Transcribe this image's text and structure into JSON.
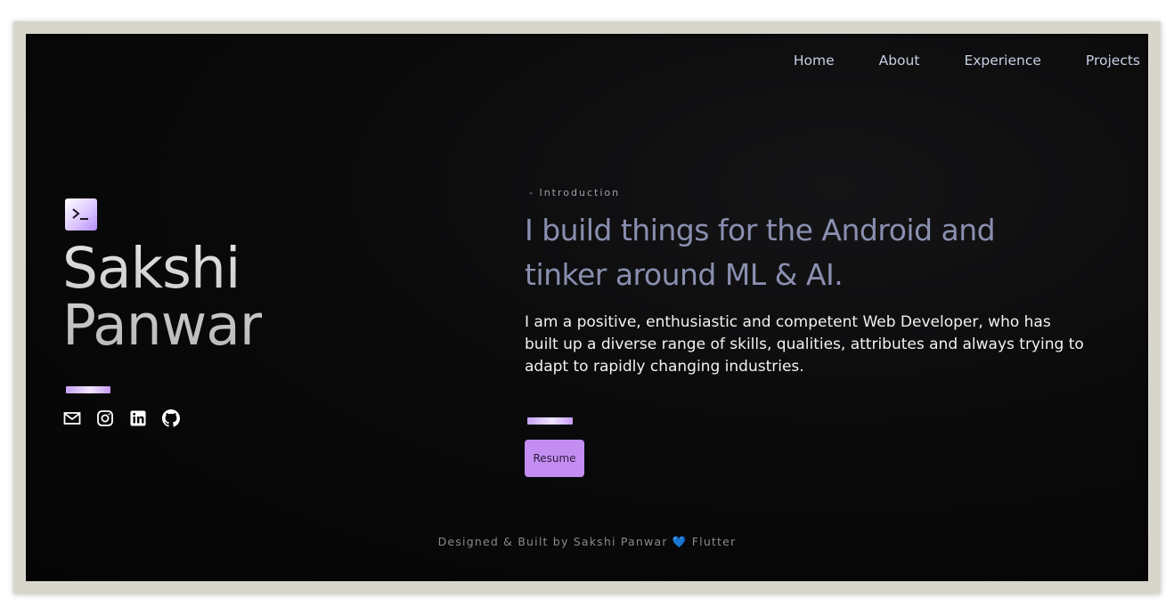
{
  "nav": {
    "items": [
      {
        "label": "Home"
      },
      {
        "label": "About"
      },
      {
        "label": "Experience"
      },
      {
        "label": "Projects"
      }
    ]
  },
  "hero": {
    "logo_icon": "terminal-icon",
    "first_name": "Sakshi",
    "last_name": "Panwar",
    "social_icons": [
      "mail-icon",
      "instagram-icon",
      "linkedin-icon",
      "github-icon"
    ]
  },
  "intro": {
    "tag": "- Introduction",
    "headline_line1": "I build things for the Android and",
    "headline_line2": "tinker around ML & AI.",
    "bio_line1": "I am a positive, enthusiastic and competent Web Developer, who has",
    "bio_line2": "built up a diverse range of skills, qualities, attributes and always trying to",
    "bio_line3": "adapt to rapidly changing industries.",
    "resume_label": "Resume"
  },
  "footer": {
    "text_before": "Designed & Built by Sakshi Panwar",
    "heart": "💙",
    "text_after": "Flutter"
  },
  "colors": {
    "accent": "#c38df2",
    "headline": "#8a8fb0",
    "background": "#0a0a0b"
  }
}
